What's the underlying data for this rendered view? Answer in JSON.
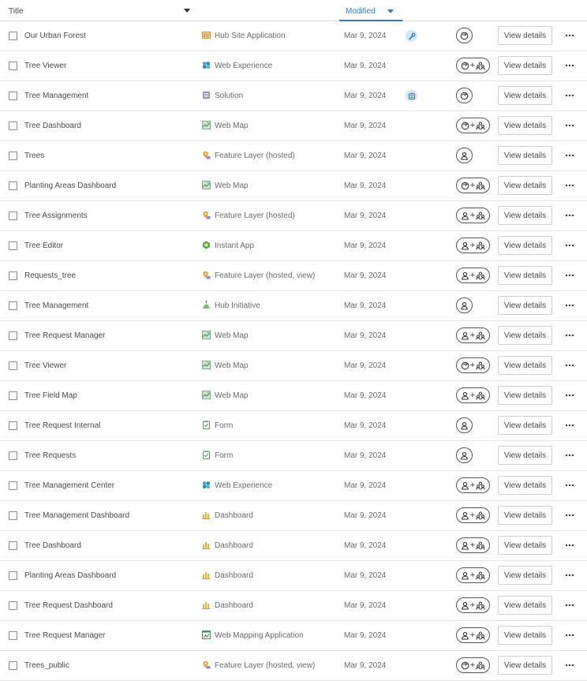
{
  "header": {
    "title_label": "Title",
    "modified_label": "Modified"
  },
  "colors": {
    "accent": "#2e7ac7",
    "badge_bg": "#d4e8f7"
  },
  "rows": [
    {
      "title": "Our Urban Forest",
      "type": "Hub Site Application",
      "icon": "hub-site-icon",
      "date": "Mar 9, 2024",
      "badge": "wrench-icon",
      "share": "org"
    },
    {
      "title": "Tree Viewer",
      "type": "Web Experience",
      "icon": "web-experience-icon",
      "date": "Mar 9, 2024",
      "badge": null,
      "share": "org+group"
    },
    {
      "title": "Tree Management",
      "type": "Solution",
      "icon": "solution-icon",
      "date": "Mar 9, 2024",
      "badge": "deploy-icon",
      "share": "org"
    },
    {
      "title": "Tree Dashboard",
      "type": "Web Map",
      "icon": "web-map-icon",
      "date": "Mar 9, 2024",
      "badge": null,
      "share": "org+group"
    },
    {
      "title": "Trees",
      "type": "Feature Layer (hosted)",
      "icon": "feature-layer-icon",
      "date": "Mar 9, 2024",
      "badge": null,
      "share": "owner"
    },
    {
      "title": "Planting Areas Dashboard",
      "type": "Web Map",
      "icon": "web-map-icon",
      "date": "Mar 9, 2024",
      "badge": null,
      "share": "org+group"
    },
    {
      "title": "Tree Assignments",
      "type": "Feature Layer (hosted)",
      "icon": "feature-layer-icon",
      "date": "Mar 9, 2024",
      "badge": null,
      "share": "owner+group"
    },
    {
      "title": "Tree Editor",
      "type": "Instant App",
      "icon": "instant-app-icon",
      "date": "Mar 9, 2024",
      "badge": null,
      "share": "owner+group"
    },
    {
      "title": "Requests_tree",
      "type": "Feature Layer (hosted, view)",
      "icon": "feature-layer-icon",
      "date": "Mar 9, 2024",
      "badge": null,
      "share": "owner+group"
    },
    {
      "title": "Tree Management",
      "type": "Hub Initiative",
      "icon": "hub-initiative-icon",
      "date": "Mar 9, 2024",
      "badge": null,
      "share": "owner"
    },
    {
      "title": "Tree Request Manager",
      "type": "Web Map",
      "icon": "web-map-icon",
      "date": "Mar 9, 2024",
      "badge": null,
      "share": "owner+group"
    },
    {
      "title": "Tree Viewer",
      "type": "Web Map",
      "icon": "web-map-icon",
      "date": "Mar 9, 2024",
      "badge": null,
      "share": "org+group"
    },
    {
      "title": "Tree Field Map",
      "type": "Web Map",
      "icon": "web-map-icon",
      "date": "Mar 9, 2024",
      "badge": null,
      "share": "owner+group"
    },
    {
      "title": "Tree Request Internal",
      "type": "Form",
      "icon": "form-icon",
      "date": "Mar 9, 2024",
      "badge": null,
      "share": "owner"
    },
    {
      "title": "Tree Requests",
      "type": "Form",
      "icon": "form-icon",
      "date": "Mar 9, 2024",
      "badge": null,
      "share": "owner"
    },
    {
      "title": "Tree Management Center",
      "type": "Web Experience",
      "icon": "web-experience-icon",
      "date": "Mar 9, 2024",
      "badge": null,
      "share": "owner+group"
    },
    {
      "title": "Tree Management Dashboard",
      "type": "Dashboard",
      "icon": "dashboard-icon",
      "date": "Mar 9, 2024",
      "badge": null,
      "share": "owner+group"
    },
    {
      "title": "Tree Dashboard",
      "type": "Dashboard",
      "icon": "dashboard-icon",
      "date": "Mar 9, 2024",
      "badge": null,
      "share": "owner+group"
    },
    {
      "title": "Planting Areas Dashboard",
      "type": "Dashboard",
      "icon": "dashboard-icon",
      "date": "Mar 9, 2024",
      "badge": null,
      "share": "owner+group"
    },
    {
      "title": "Tree Request Dashboard",
      "type": "Dashboard",
      "icon": "dashboard-icon",
      "date": "Mar 9, 2024",
      "badge": null,
      "share": "owner+group"
    },
    {
      "title": "Tree Request Manager",
      "type": "Web Mapping Application",
      "icon": "web-mapping-app-icon",
      "date": "Mar 9, 2024",
      "badge": null,
      "share": "owner+group"
    },
    {
      "title": "Trees_public",
      "type": "Feature Layer (hosted, view)",
      "icon": "feature-layer-icon",
      "date": "Mar 9, 2024",
      "badge": null,
      "share": "org+group"
    }
  ],
  "view_details_label": "View details"
}
